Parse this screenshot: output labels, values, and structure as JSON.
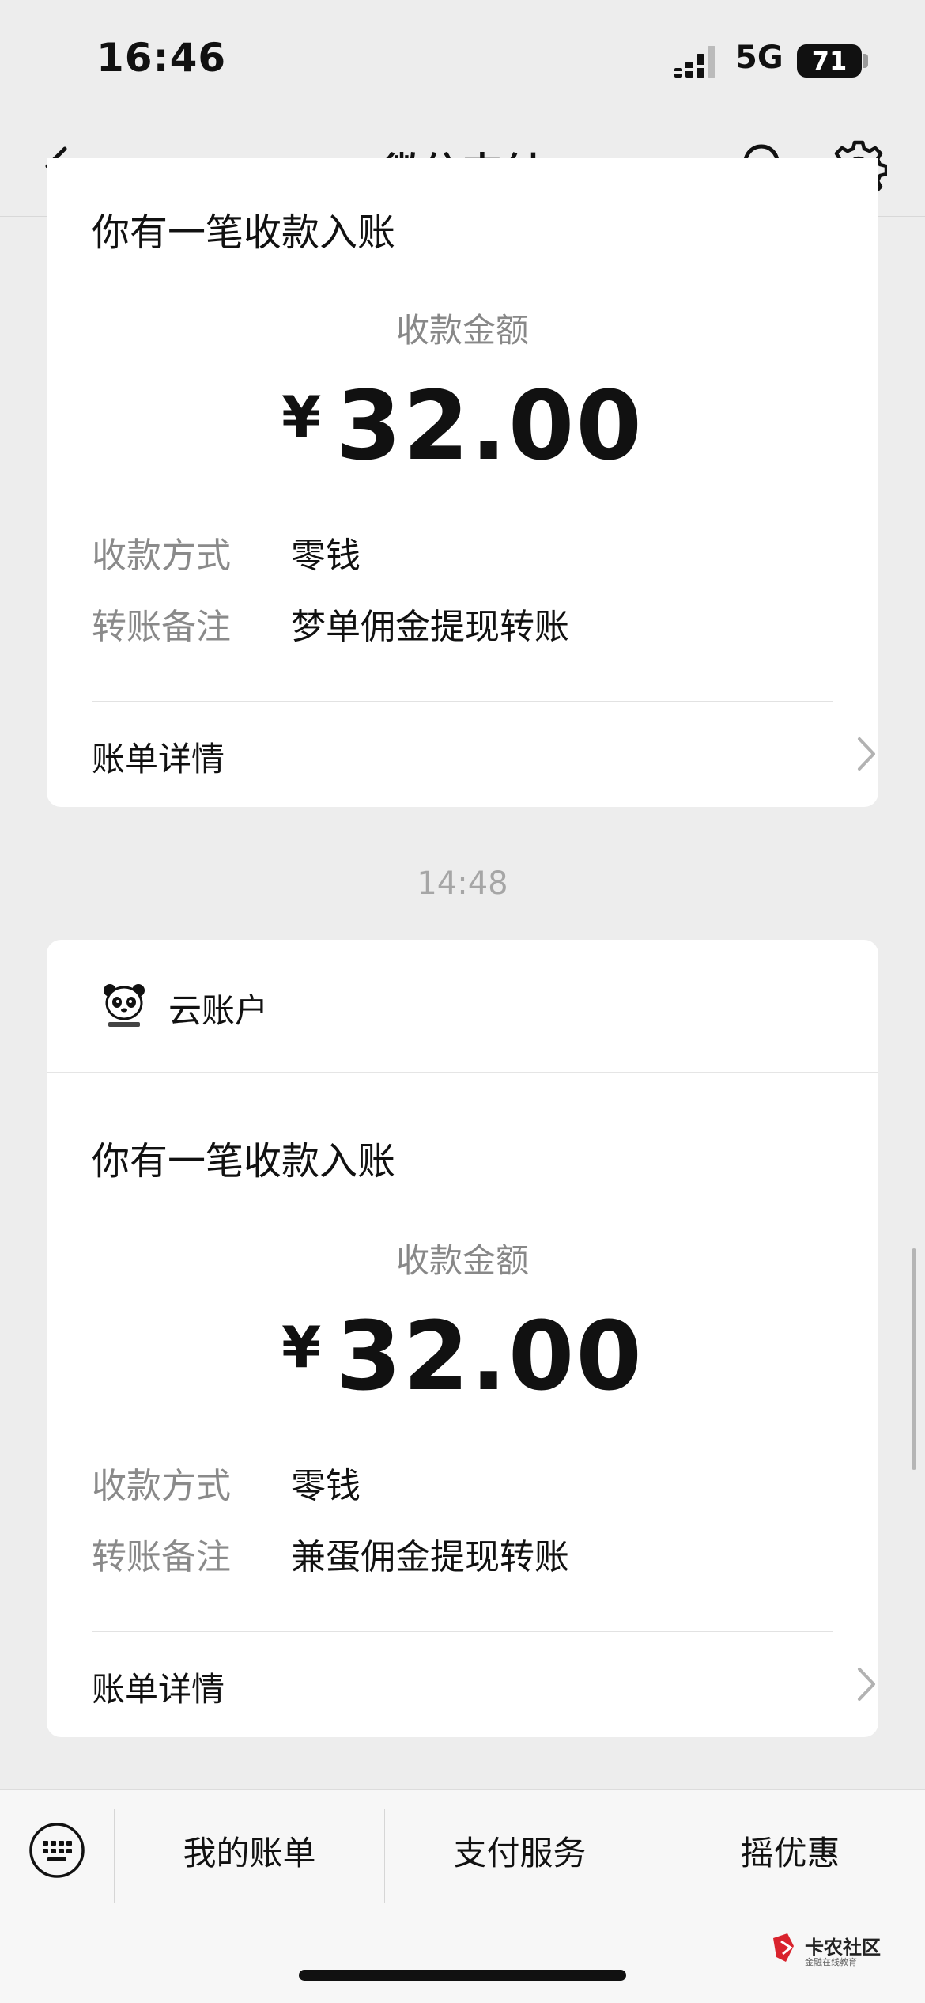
{
  "status_bar": {
    "time": "16:46",
    "network": "5G",
    "battery": "71"
  },
  "nav": {
    "title": "微信支付",
    "back_icon": "back-arrow-icon",
    "search_icon": "search-icon",
    "settings_icon": "gear-icon"
  },
  "messages": [
    {
      "title": "你有一笔收款入账",
      "amount_label": "收款金额",
      "currency": "¥",
      "amount": "32.00",
      "method_label": "收款方式",
      "method_value": "零钱",
      "remark_label": "转账备注",
      "remark_value": "梦单佣金提现转账",
      "detail_label": "账单详情"
    },
    {
      "time": "14:48",
      "account_name": "云账户",
      "title": "你有一笔收款入账",
      "amount_label": "收款金额",
      "currency": "¥",
      "amount": "32.00",
      "method_label": "收款方式",
      "method_value": "零钱",
      "remark_label": "转账备注",
      "remark_value": "兼蛋佣金提现转账",
      "detail_label": "账单详情"
    }
  ],
  "tabbar": {
    "tabs": [
      "我的账单",
      "支付服务",
      "摇优惠"
    ],
    "keyboard_icon": "keyboard-icon"
  },
  "watermark": {
    "name": "卡农社区",
    "tagline": "金融在线教育"
  }
}
